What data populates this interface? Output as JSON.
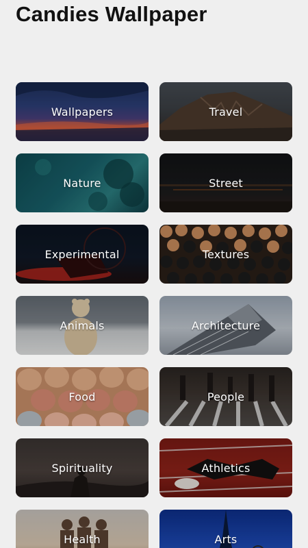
{
  "header": {
    "title": "Candies Wallpaper"
  },
  "categories": [
    {
      "label": "Wallpapers"
    },
    {
      "label": "Travel"
    },
    {
      "label": "Nature"
    },
    {
      "label": "Street"
    },
    {
      "label": "Experimental"
    },
    {
      "label": "Textures"
    },
    {
      "label": "Animals"
    },
    {
      "label": "Architecture"
    },
    {
      "label": "Food"
    },
    {
      "label": "People"
    },
    {
      "label": "Spirituality"
    },
    {
      "label": "Athletics"
    },
    {
      "label": "Health"
    },
    {
      "label": "Arts"
    }
  ]
}
